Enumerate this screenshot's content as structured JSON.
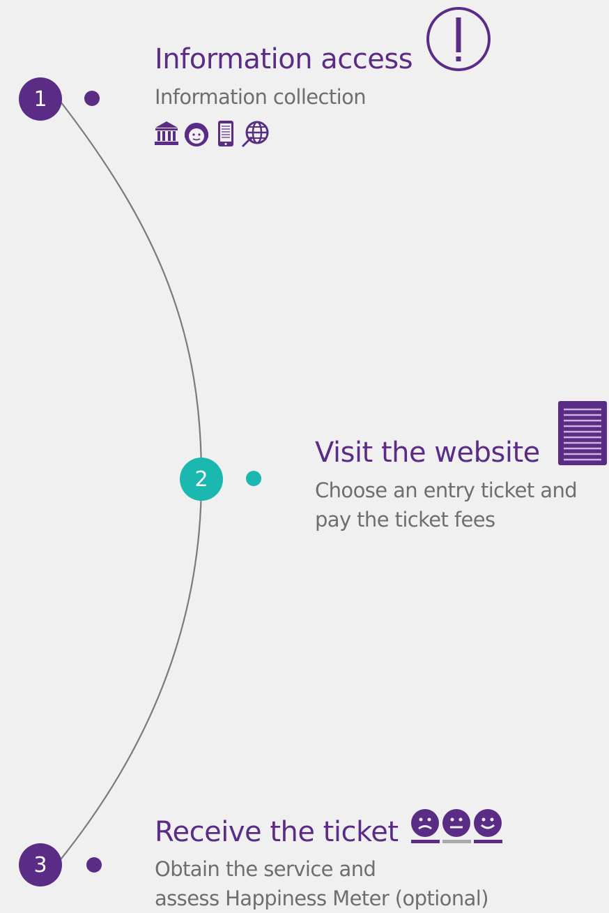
{
  "colors": {
    "purple": "#5b2c86",
    "teal": "#1ab8ae",
    "gray_text": "#6e6e6e",
    "arc": "#7a7a7a",
    "background": "#f0f0f0"
  },
  "steps": [
    {
      "number": "1",
      "title": "Information access",
      "description": [
        "Information collection"
      ],
      "title_icon": "exclamation-circle-icon",
      "channel_icons": [
        "bank-icon",
        "call-center-agent-icon",
        "mobile-phone-icon",
        "website-globe-icon"
      ]
    },
    {
      "number": "2",
      "title": "Visit the website",
      "description": [
        "Choose an entry ticket and",
        "pay the ticket fees"
      ],
      "title_icon": "document-form-icon"
    },
    {
      "number": "3",
      "title": "Receive the ticket",
      "description": [
        "Obtain the service and",
        "assess Happiness  Meter (optional)"
      ],
      "title_icon": "happiness-meter-icon"
    }
  ]
}
